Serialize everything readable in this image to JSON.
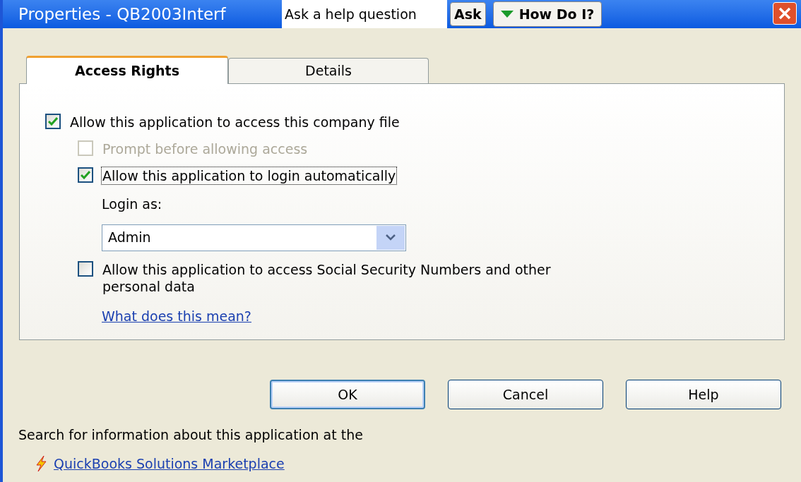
{
  "window": {
    "title": "Properties - QB2003Interf"
  },
  "help_bar": {
    "placeholder": "Ask a help question",
    "ask_button": "Ask",
    "how_do_i_button": "How Do I?"
  },
  "tabs": [
    {
      "label": "Access Rights",
      "selected": true
    },
    {
      "label": "Details",
      "selected": false
    }
  ],
  "options": [
    {
      "kind": "checkbox",
      "label": "Allow this application to access this company file",
      "checked": true,
      "disabled": false,
      "focused": false,
      "children": [
        {
          "kind": "checkbox",
          "label": "Prompt before allowing access",
          "checked": false,
          "disabled": true,
          "focused": false
        },
        {
          "kind": "checkbox",
          "label": "Allow this application to login automatically",
          "checked": true,
          "disabled": false,
          "focused": true
        },
        {
          "kind": "dropdown",
          "label": "Login as:",
          "value": "Admin"
        },
        {
          "kind": "checkbox",
          "label": "Allow this application to access Social Security Numbers and other personal data",
          "checked": false,
          "disabled": false,
          "focused": false
        },
        {
          "kind": "link",
          "label": "What does this mean?"
        }
      ]
    }
  ],
  "buttons": [
    "OK",
    "Cancel",
    "Help"
  ],
  "footer": {
    "text": "Search for information about this application at the",
    "link": "QuickBooks Solutions Marketplace"
  }
}
